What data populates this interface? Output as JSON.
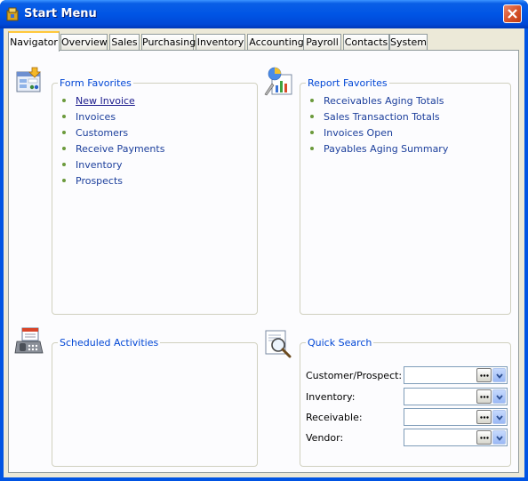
{
  "window": {
    "title": "Start Menu"
  },
  "tabs": [
    {
      "label": "Navigator",
      "active": true
    },
    {
      "label": "Overview"
    },
    {
      "label": "Sales"
    },
    {
      "label": "Purchasing"
    },
    {
      "label": "Inventory"
    },
    {
      "label": "Accounting"
    },
    {
      "label": "Payroll"
    },
    {
      "label": "Contacts"
    },
    {
      "label": "System"
    }
  ],
  "form_favorites": {
    "title": "Form Favorites",
    "items": [
      "New Invoice",
      "Invoices",
      "Customers",
      "Receive Payments",
      "Inventory",
      "Prospects"
    ]
  },
  "report_favorites": {
    "title": "Report Favorites",
    "items": [
      "Receivables Aging Totals",
      "Sales Transaction Totals",
      "Invoices Open",
      "Payables Aging Summary"
    ]
  },
  "scheduled_activities": {
    "title": "Scheduled Activities"
  },
  "quick_search": {
    "title": "Quick Search",
    "fields": [
      {
        "label": "Customer/Prospect:",
        "value": ""
      },
      {
        "label": "Inventory:",
        "value": ""
      },
      {
        "label": "Receivable:",
        "value": ""
      },
      {
        "label": "Vendor:",
        "value": ""
      }
    ]
  },
  "colors": {
    "titlebar": "#0055e5",
    "link": "#1c3f9c",
    "group_title": "#0046d5",
    "tab_highlight": "#ffc83c"
  }
}
